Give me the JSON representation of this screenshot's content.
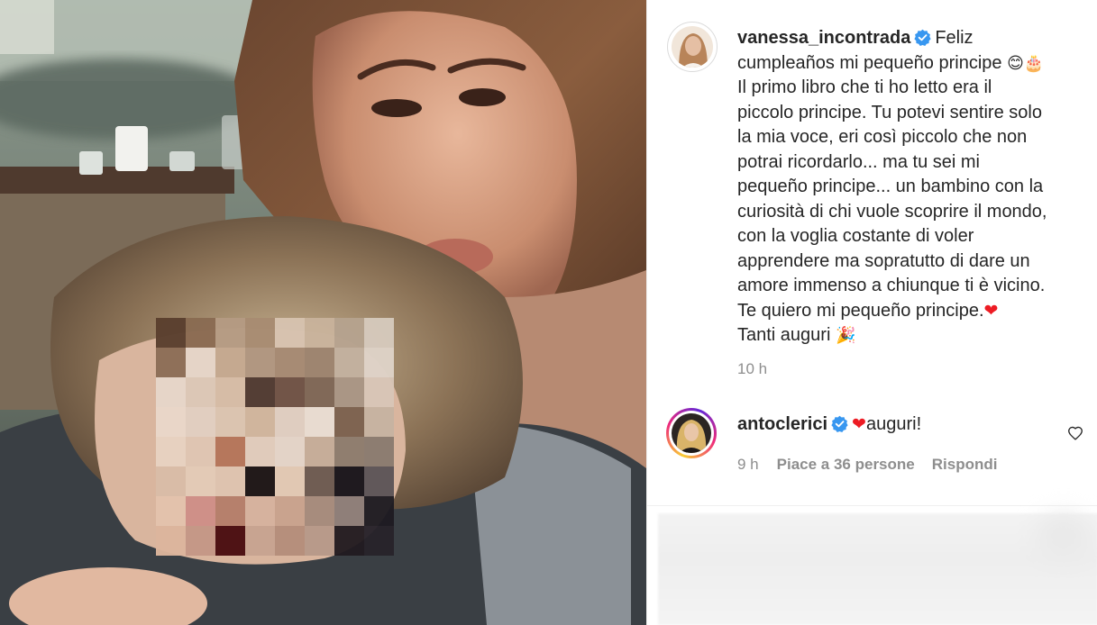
{
  "post": {
    "author": "vanessa_incontrada",
    "caption_lines": [
      "cumpleaños mi pequeño principe",
      "Il primo libro che ti ho letto era il",
      "piccolo principe. Tu potevi sentire solo",
      "la mia voce, eri così piccolo che non",
      "potrai ricordarlo... ma tu sei mi",
      "pequeño principe... un bambino con la",
      "curiosità di chi vuole scoprire il mondo,",
      "con la voglia costante di voler",
      "apprendere ma sopratutto di dare un",
      "amore immenso a chiunque ti è vicino.",
      "Te quiero mi pequeño principe.",
      "Tanti auguri"
    ],
    "caption_first_word": "Feliz",
    "emoji_smile": "😊",
    "emoji_cake": "🎂",
    "emoji_heart": "❤",
    "emoji_party": "🎉",
    "time": "10 h"
  },
  "comment": {
    "author": "antoclerici",
    "heart": "❤",
    "text": "auguri!",
    "time": "9 h",
    "likes": "Piace a 36 persone",
    "reply": "Rispondi"
  },
  "icons": {
    "verified": "verified-badge-icon",
    "like": "heart-outline-icon"
  },
  "colors": {
    "verified_blue": "#3897f0",
    "muted_text": "#8e8e8e",
    "text": "#262626",
    "heart_red": "#ed1c24"
  }
}
